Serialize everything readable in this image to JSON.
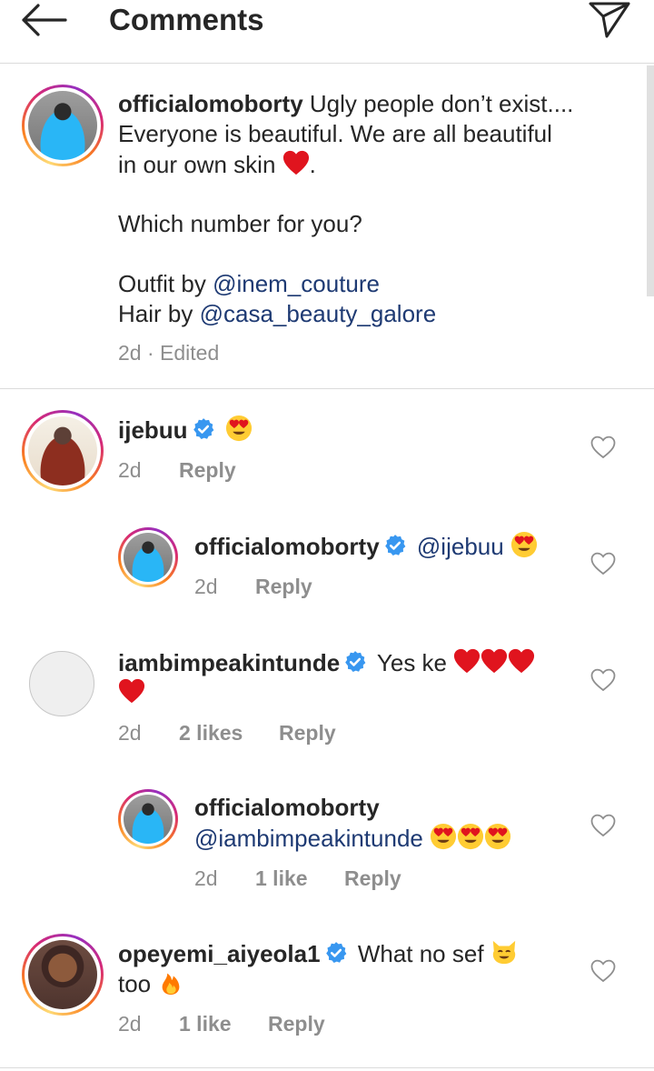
{
  "header": {
    "title": "Comments"
  },
  "caption": {
    "username": "officialomoborty",
    "line1_rest": "Ugly people don’t exist....",
    "line2": "Everyone is beautiful. We are all beautiful",
    "line3": "in our own skin",
    "line3_end": ".",
    "question": "Which number for you?",
    "outfit_label": "Outfit by",
    "outfit_handle": "@inem_couture",
    "hair_label": "Hair by",
    "hair_handle": "@casa_beauty_galore",
    "meta": "2d · Edited"
  },
  "comments": [
    {
      "username": "ijebuu",
      "time": "2d",
      "reply": "Reply"
    },
    {
      "username": "officialomoborty",
      "mention": "@ijebuu",
      "time": "2d",
      "reply": "Reply"
    },
    {
      "username": "iambimpeakintunde",
      "text": "Yes ke",
      "time": "2d",
      "likes": "2 likes",
      "reply": "Reply"
    },
    {
      "username": "officialomoborty",
      "mention": "@iambimpeakintunde",
      "time": "2d",
      "likes": "1 like",
      "reply": "Reply"
    },
    {
      "username": "opeyemi_aiyeola1",
      "text": "What no sef",
      "text2": "too",
      "time": "2d",
      "likes": "1 like",
      "reply": "Reply"
    }
  ],
  "icons": {
    "back": "back-arrow-icon",
    "send": "direct-send-icon",
    "like": "heart-outline-icon",
    "verified": "verified-badge-icon"
  },
  "colors": {
    "mention": "#1e3a73",
    "verified": "#3897f0",
    "heart": "#e0141e",
    "meta": "#8e8e8e"
  }
}
